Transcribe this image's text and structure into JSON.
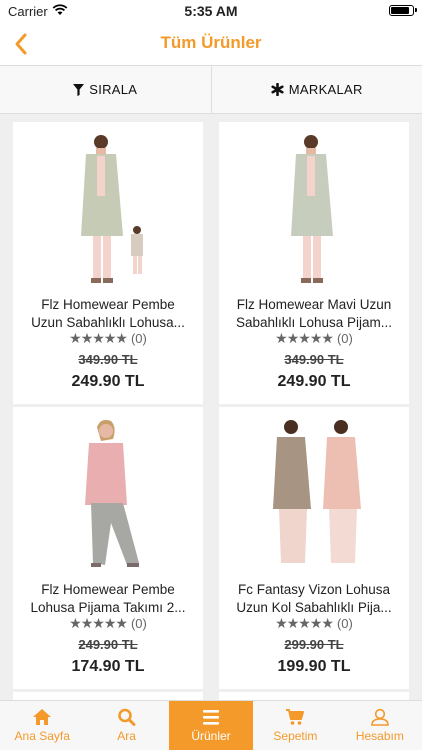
{
  "status": {
    "carrier": "Carrier",
    "time": "5:35 AM"
  },
  "nav": {
    "title": "Tüm Ürünler",
    "back_icon": "chevron-left-icon"
  },
  "filters": {
    "sort_label": "SIRALA",
    "brands_label": "MARKALAR"
  },
  "products": [
    {
      "line1": "Flz Homewear Pembe",
      "line2": "Uzun Sabahlıklı Lohusa...",
      "rating": "(0)",
      "old_price": "349.90 TL",
      "price": "249.90 TL"
    },
    {
      "line1": "Flz Homewear Mavi Uzun",
      "line2": "Sabahlıklı Lohusa Pijam...",
      "rating": "(0)",
      "old_price": "349.90 TL",
      "price": "249.90 TL"
    },
    {
      "line1": "Flz Homewear Pembe",
      "line2": "Lohusa Pijama Takımı 2...",
      "rating": "(0)",
      "old_price": "249.90 TL",
      "price": "174.90 TL"
    },
    {
      "line1": "Fc Fantasy Vizon Lohusa",
      "line2": "Uzun Kol Sabahlıklı Pija...",
      "rating": "(0)",
      "old_price": "299.90 TL",
      "price": "199.90 TL"
    }
  ],
  "tabs": [
    {
      "label": "Ana Sayfa",
      "icon": "home-icon"
    },
    {
      "label": "Ara",
      "icon": "search-icon"
    },
    {
      "label": "Ürünler",
      "icon": "menu-icon"
    },
    {
      "label": "Sepetim",
      "icon": "cart-icon"
    },
    {
      "label": "Hesabım",
      "icon": "user-icon"
    }
  ],
  "colors": {
    "accent": "#f39a2b"
  }
}
